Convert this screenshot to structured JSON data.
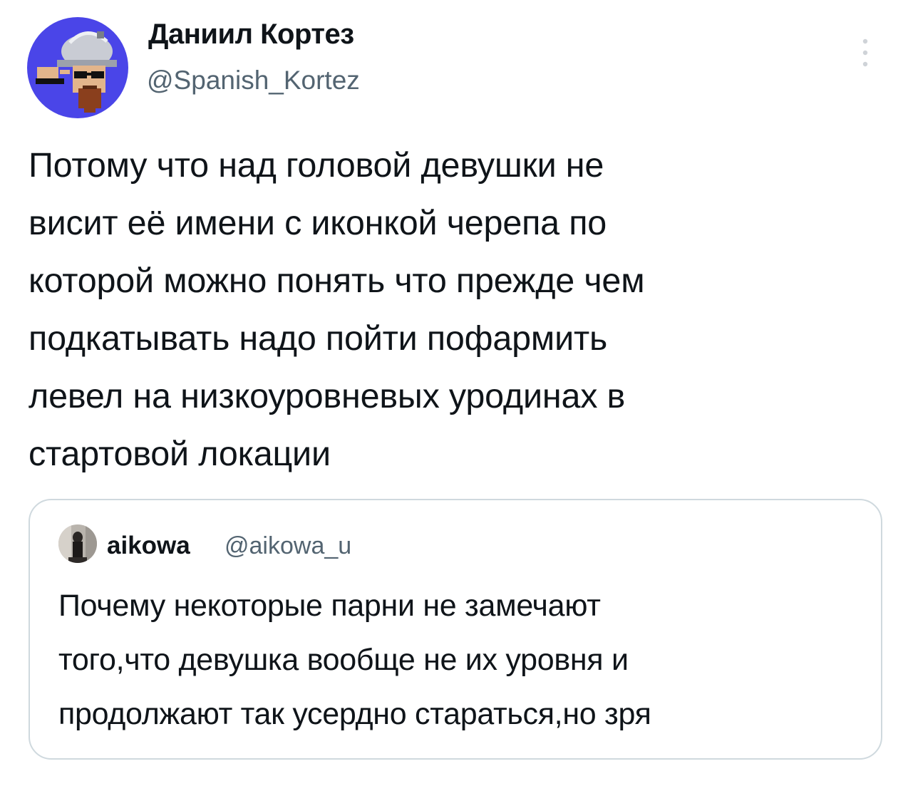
{
  "tweet": {
    "author": {
      "name": "Даниил Кортез",
      "handle": "@Spanish_Kortez"
    },
    "text": "Потому что над головой девушки не\nвисит её имени с иконкой черепа по\nкоторой можно понять что прежде чем\nподкатывать надо пойти пофармить\nлевел на низкоуровневых уродинах в\nстартовой локации",
    "more_icon": "vertical-dots-icon"
  },
  "quoted_tweet": {
    "author": {
      "name": "aikowa",
      "handle": "@aikowa_u"
    },
    "text": "Почему некоторые парни не замечают\nтого,что девушка вообще не их уровня и\nпродолжают так усердно стараться,но зря"
  },
  "colors": {
    "text_primary": "#0f1419",
    "text_secondary": "#536471",
    "border": "#cfd9de",
    "avatar_background": "#4a45e8"
  }
}
